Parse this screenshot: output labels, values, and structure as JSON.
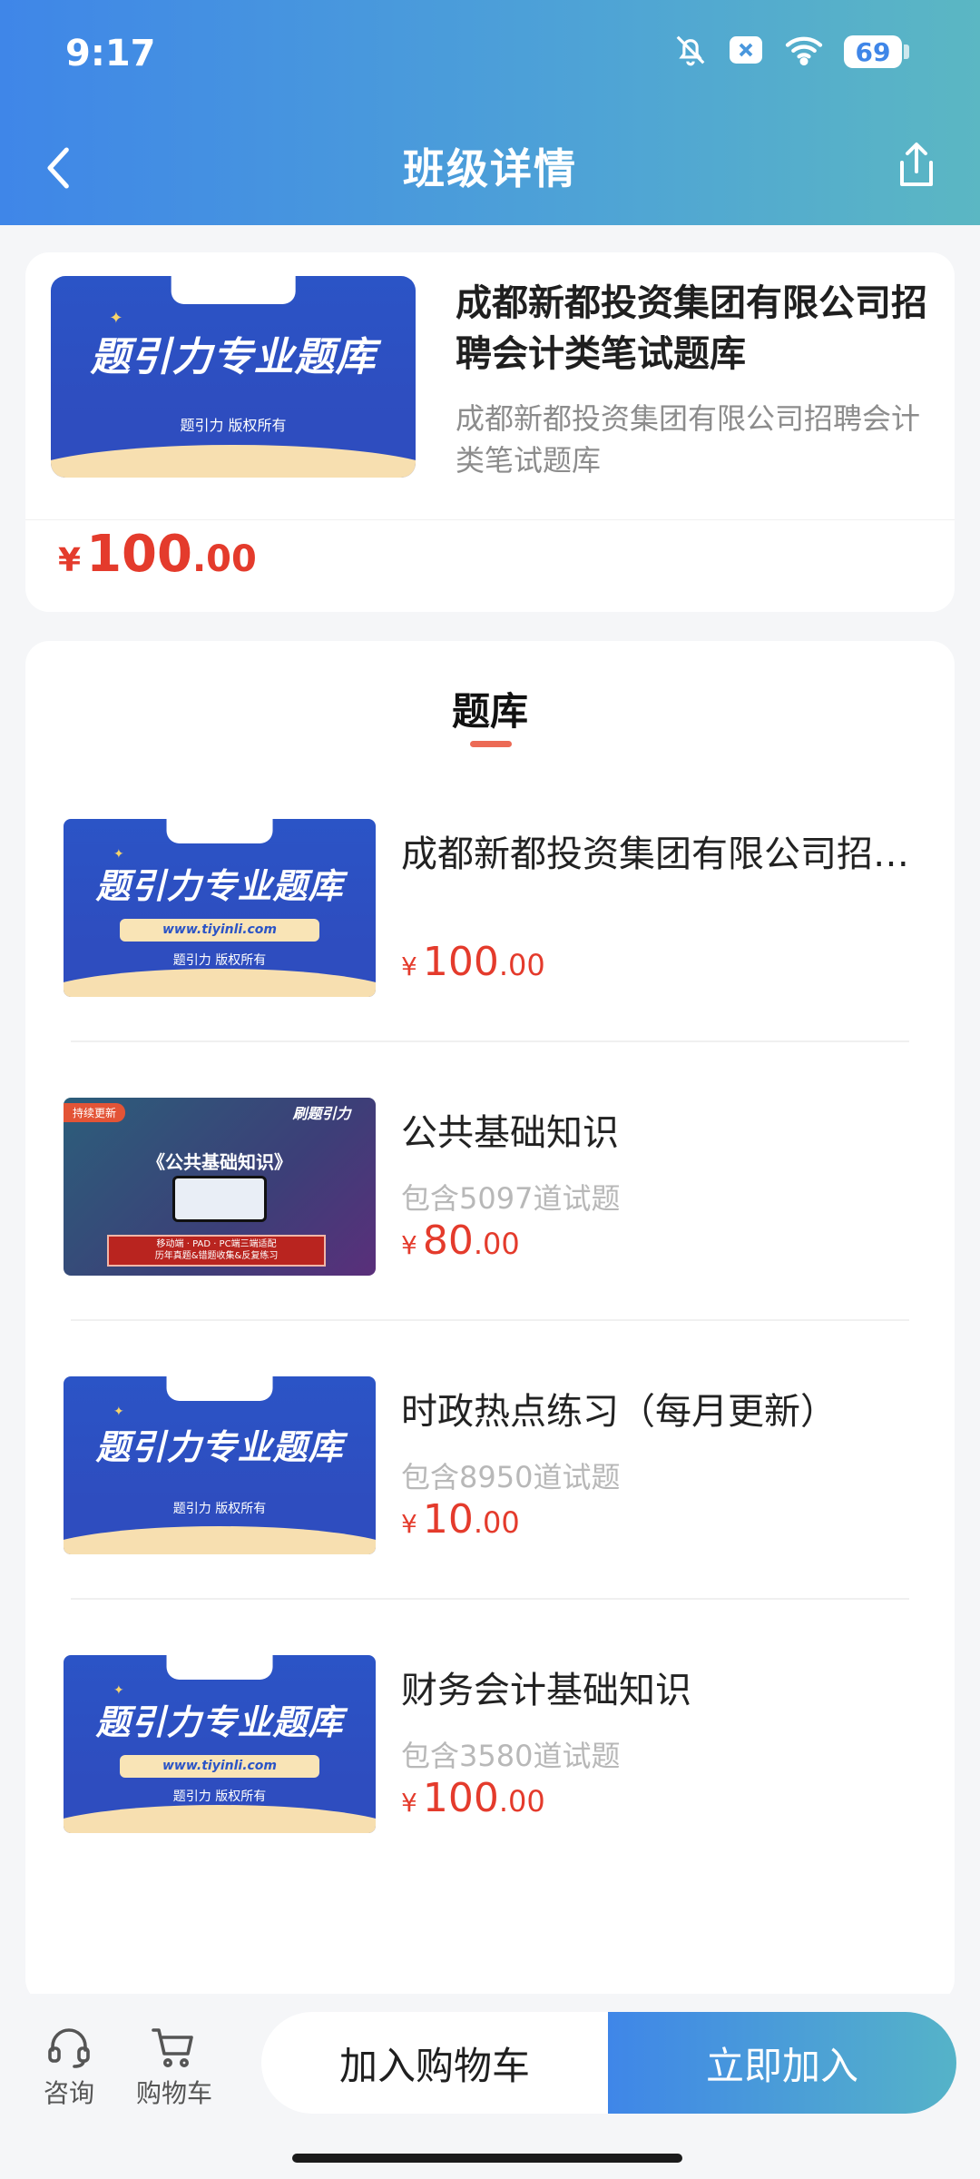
{
  "status_bar": {
    "time": "9:17",
    "battery": "69"
  },
  "nav": {
    "title": "班级详情"
  },
  "class": {
    "title": "成都新都投资集团有限公司招聘会计类笔试题库",
    "subtitle": "成都新都投资集团有限公司招聘会计类笔试题库",
    "price_symbol": "¥",
    "price_int": "100",
    "price_dec": ".00"
  },
  "section": {
    "title": "题库"
  },
  "thumb": {
    "heading": "题引力专业题库",
    "url": "www.tiyinli.com",
    "copyright": "题引力 版权所有",
    "dark_badge": "持续更新",
    "dark_brand": "刷题引力",
    "dark_heading": "《公共基础知识》",
    "dark_bar_line1": "移动端 · PAD · PC端三端适配",
    "dark_bar_line2": "历年真题&错题收集&反复练习"
  },
  "items": [
    {
      "title": "成都新都投资集团有限公司招聘会计类笔试题库",
      "count": "",
      "price_int": "100",
      "price_dec": ".00"
    },
    {
      "title": "公共基础知识",
      "count": "包含5097道试题",
      "price_int": "80",
      "price_dec": ".00"
    },
    {
      "title": "时政热点练习（每月更新）",
      "count": "包含8950道试题",
      "price_int": "10",
      "price_dec": ".00"
    },
    {
      "title": "财务会计基础知识",
      "count": "包含3580道试题",
      "price_int": "100",
      "price_dec": ".00"
    }
  ],
  "price_symbol": "¥",
  "bottom_bar": {
    "consult_label": "咨询",
    "cart_label": "购物车",
    "add_cart_label": "加入购物车",
    "join_label": "立即加入"
  },
  "icons": {
    "back": "chevron-left-icon",
    "share": "share-icon",
    "mute": "bell-off-icon",
    "close_box": "close-box-icon",
    "wifi": "wifi-icon",
    "consult": "headset-icon",
    "cart": "cart-icon"
  },
  "colors": {
    "header_start": "#3f86e8",
    "header_end": "#5bb7c3",
    "price": "#e43b2c",
    "underline": "#ec6a55"
  }
}
